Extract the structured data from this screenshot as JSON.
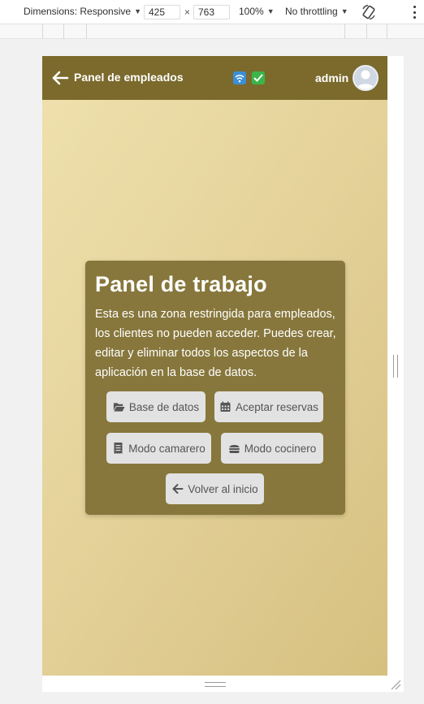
{
  "devtools": {
    "device_label": "Dimensions: Responsive",
    "width_value": "425",
    "height_value": "763",
    "times": "×",
    "zoom_label": "100%",
    "throttling_label": "No throttling"
  },
  "app": {
    "header": {
      "title": "Panel de empleados",
      "user": "admin"
    },
    "panel": {
      "title": "Panel de trabajo",
      "description": "Esta es una zona restringida para empleados, los clientes no pueden acceder. Puedes crear, editar y eliminar todos los aspectos de la aplicación en la base de datos.",
      "buttons": {
        "database": "Base de datos",
        "accept_reservations": "Aceptar reservas",
        "waiter_mode": "Modo camarero",
        "cook_mode": "Modo cocinero",
        "back_home": "Volver al inicio"
      }
    }
  },
  "colors": {
    "header_bg": "#7b6a2c",
    "panel_bg": "#87773c",
    "button_bg": "#e2e2e2",
    "page_gradient": [
      "#efe1ae",
      "#d6c080"
    ]
  },
  "icons": [
    "arrow-left-icon",
    "wifi-icon",
    "checkmark-icon",
    "user-avatar-icon",
    "folder-open-icon",
    "calendar-icon",
    "receipt-icon",
    "burger-icon",
    "rotate-icon",
    "kebab-menu-icon"
  ]
}
